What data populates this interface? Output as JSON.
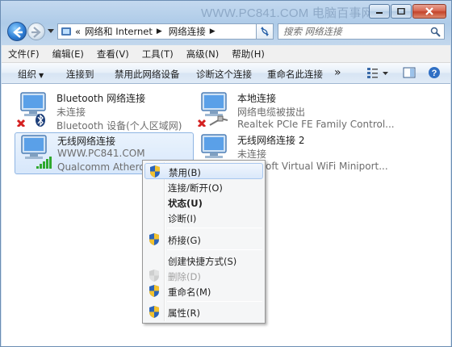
{
  "window": {
    "watermark": "WWW.PC841.COM 电脑百事网"
  },
  "address": {
    "prefix": "«",
    "path": [
      "网络和 Internet",
      "网络连接"
    ],
    "search_placeholder": "搜索 网络连接"
  },
  "menubar": {
    "items": [
      "文件(F)",
      "编辑(E)",
      "查看(V)",
      "工具(T)",
      "高级(N)",
      "帮助(H)"
    ]
  },
  "commands": {
    "organize": "组织",
    "connect_to": "连接到",
    "disable_device": "禁用此网络设备",
    "diagnose": "诊断这个连接",
    "rename": "重命名此连接",
    "more": "»"
  },
  "connections": [
    {
      "name": "Bluetooth 网络连接",
      "status": "未连接",
      "device": "Bluetooth 设备(个人区域网)"
    },
    {
      "name": "本地连接",
      "status": "网络电缆被拔出",
      "device": "Realtek PCIe FE Family Control..."
    },
    {
      "name": "无线网络连接",
      "status": "WWW.PC841.COM",
      "device": "Qualcomm Atheros A"
    },
    {
      "name": "无线网络连接 2",
      "status": "未连接",
      "device": "oft Virtual WiFi Miniport..."
    }
  ],
  "context_menu": {
    "items": [
      {
        "label": "禁用(B)",
        "shield": true,
        "state": "highlighted"
      },
      {
        "label": "连接/断开(O)",
        "shield": false,
        "state": "normal"
      },
      {
        "label": "状态(U)",
        "shield": false,
        "state": "bold"
      },
      {
        "label": "诊断(I)",
        "shield": false,
        "state": "normal"
      },
      {
        "label": "桥接(G)",
        "shield": true,
        "state": "normal"
      },
      {
        "label": "创建快捷方式(S)",
        "shield": false,
        "state": "normal"
      },
      {
        "label": "删除(D)",
        "shield": true,
        "state": "disabled"
      },
      {
        "label": "重命名(M)",
        "shield": true,
        "state": "normal"
      },
      {
        "label": "属性(R)",
        "shield": true,
        "state": "normal"
      }
    ]
  },
  "colors": {
    "accent": "#2f7fd6",
    "signal_green": "#2ea82e",
    "error_red": "#d42020"
  }
}
